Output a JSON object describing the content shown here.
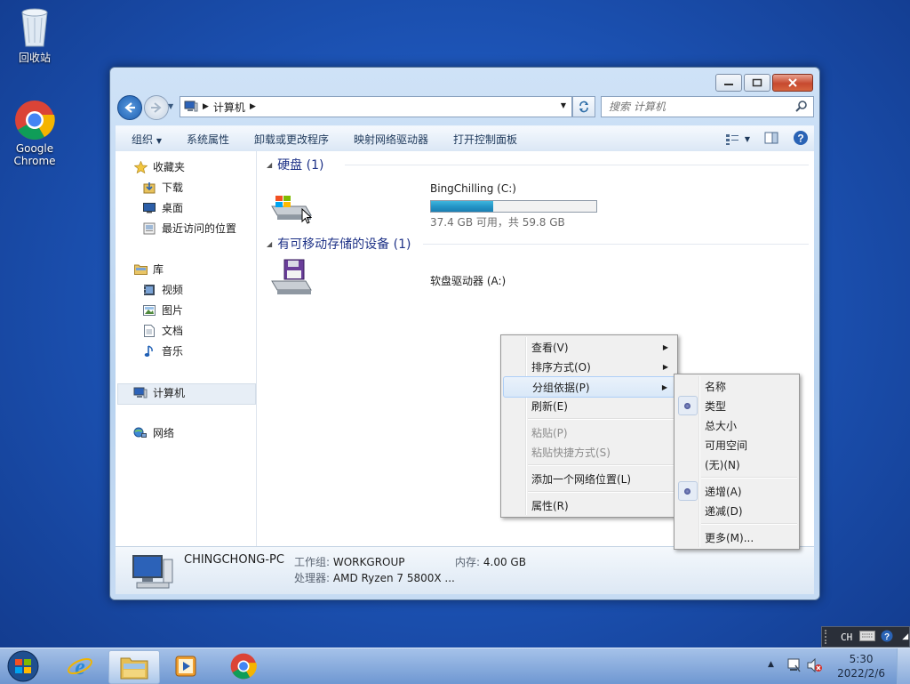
{
  "desktop": {
    "icons": [
      {
        "label": "回收站",
        "icon": "recycle-bin-icon"
      },
      {
        "label": "Google\nChrome",
        "icon": "chrome-icon"
      }
    ]
  },
  "window": {
    "address": {
      "root_icon": "computer-icon",
      "path": [
        "计算机"
      ]
    },
    "search": {
      "placeholder": "搜索 计算机"
    },
    "toolbar": {
      "organize": "组织",
      "items": [
        "系统属性",
        "卸载或更改程序",
        "映射网络驱动器",
        "打开控制面板"
      ]
    },
    "nav": {
      "favorites": "收藏夹",
      "favorites_items": [
        "下载",
        "桌面",
        "最近访问的位置"
      ],
      "libraries": "库",
      "libraries_items": [
        "视频",
        "图片",
        "文档",
        "音乐"
      ],
      "computer": "计算机",
      "network": "网络"
    },
    "groups": [
      {
        "title": "硬盘 (1)",
        "drives": [
          {
            "name": "BingChilling (C:)",
            "free": "37.4 GB 可用，共 59.8 GB",
            "used_fraction": 0.375
          }
        ]
      },
      {
        "title": "有可移动存储的设备 (1)",
        "drives": [
          {
            "name": "软盘驱动器 (A:)"
          }
        ]
      }
    ],
    "details": {
      "pc_name": "CHINGCHONG-PC",
      "workgroup_label": "工作组:",
      "workgroup": "WORKGROUP",
      "memory_label": "内存:",
      "memory": "4.00 GB",
      "cpu_label": "处理器:",
      "cpu": "AMD Ryzen 7 5800X ..."
    }
  },
  "context_menu": {
    "items": [
      {
        "label": "查看(V)",
        "submenu": true
      },
      {
        "label": "排序方式(O)",
        "submenu": true
      },
      {
        "label": "分组依据(P)",
        "submenu": true,
        "highlighted": true
      },
      {
        "label": "刷新(E)"
      },
      {
        "label": "粘贴(P)",
        "disabled": true
      },
      {
        "label": "粘贴快捷方式(S)",
        "disabled": true
      },
      {
        "label": "添加一个网络位置(L)"
      },
      {
        "label": "属性(R)"
      }
    ]
  },
  "group_submenu": {
    "items": [
      {
        "label": "名称",
        "checked": false
      },
      {
        "label": "类型",
        "checked": true
      },
      {
        "label": "总大小",
        "checked": false
      },
      {
        "label": "可用空间",
        "checked": false
      },
      {
        "label": "(无)(N)",
        "checked": false
      },
      {
        "label": "递增(A)",
        "checked": true
      },
      {
        "label": "递减(D)",
        "checked": false
      },
      {
        "label": "更多(M)...",
        "checked": false
      }
    ]
  },
  "language_bar": {
    "code": "CH"
  },
  "taskbar": {
    "apps": [
      "ie-icon",
      "explorer-icon",
      "media-player-icon",
      "chrome-icon"
    ],
    "active": "explorer-icon",
    "clock": {
      "time": "5:30",
      "date": "2022/2/6"
    }
  }
}
